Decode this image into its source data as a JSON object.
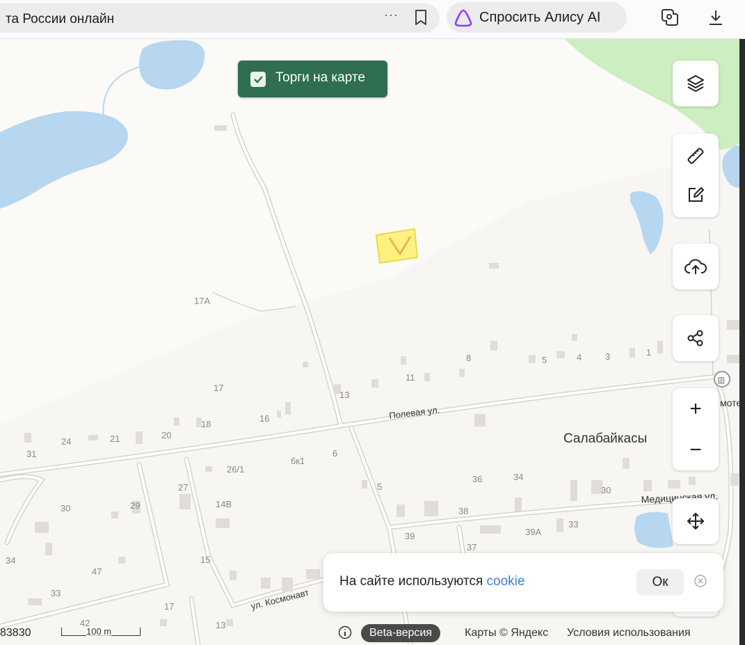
{
  "browser": {
    "address_text": "та России онлайн",
    "more_glyph": "···",
    "alice_button_label": "Спросить Алису AI",
    "icons": [
      "bookmark-icon",
      "alice-logo-icon",
      "extension-icon",
      "download-icon"
    ]
  },
  "map_overlay": {
    "torgi_label": "Торги на карте",
    "torgi_checked": true
  },
  "controls": {
    "layers": "layers-icon",
    "ruler": "ruler-icon",
    "edit": "edit-icon",
    "upload": "cloud-upload-icon",
    "share": "share-icon",
    "zoom_in": "+",
    "zoom_out": "−",
    "move": "move-arrows-icon"
  },
  "map_labels": {
    "settlement": "Салабайкасы",
    "street_polevaya": "Полевая ул.",
    "street_kosmonavtov": "ул. Космонавт",
    "street_medic": "Медицинская ул.",
    "street_edge": "моте",
    "house_numbers": [
      "17А",
      "17",
      "13",
      "11",
      "8",
      "5",
      "4",
      "3",
      "1",
      "24",
      "21",
      "20",
      "18",
      "16",
      "31",
      "26/1",
      "6к1",
      "6",
      "27",
      "14В",
      "30",
      "29",
      "36",
      "34",
      "30",
      "38",
      "5",
      "39",
      "39А",
      "33",
      "37",
      "34",
      "47",
      "15",
      "33",
      "17",
      "13",
      "42"
    ]
  },
  "cookie_banner": {
    "text_before": "На сайте используются",
    "link": "cookie",
    "ok_label": "Ок"
  },
  "footer": {
    "coordinate_text": "83830",
    "scale_label": "100 m",
    "beta_label": "Beta-версия",
    "copyright": "Карты © Яндекс",
    "terms": "Условия использования"
  },
  "colors": {
    "map_background": "#f6f5f1",
    "forest": "#cdeec0",
    "water": "#b7d7f0",
    "road": "#ffffff",
    "road_outline": "#d8d6d0",
    "building": "#e0ddd8",
    "torgi_green": "#2f6e4f",
    "highlight_parcel": "#fff176",
    "link_blue": "#3d7ed6"
  }
}
